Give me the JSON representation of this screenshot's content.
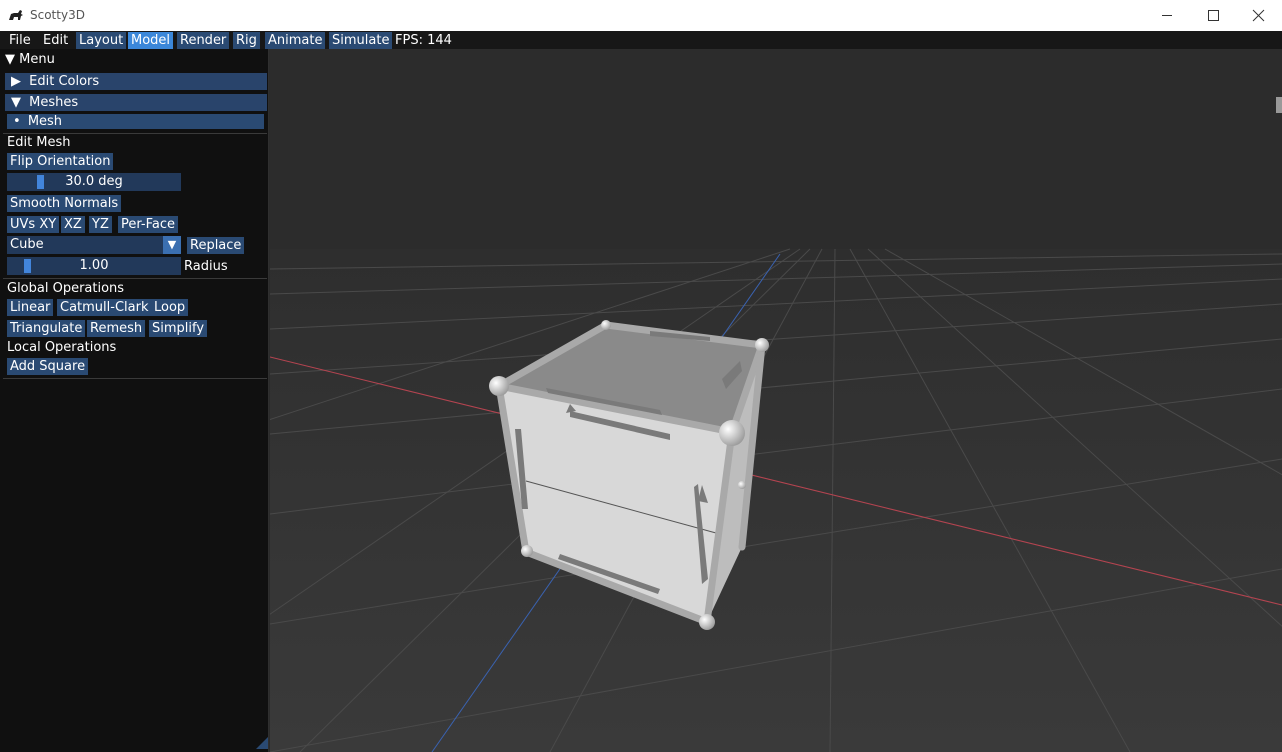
{
  "window": {
    "title": "Scotty3D"
  },
  "menubar": {
    "items": [
      {
        "label": "File",
        "style": "plain"
      },
      {
        "label": "Edit",
        "style": "plain"
      },
      {
        "label": "Layout",
        "style": "boxed"
      },
      {
        "label": "Model",
        "style": "active"
      },
      {
        "label": "Render",
        "style": "boxed"
      },
      {
        "label": "Rig",
        "style": "boxed"
      },
      {
        "label": "Animate",
        "style": "boxed"
      },
      {
        "label": "Simulate",
        "style": "boxed"
      }
    ],
    "fps_label": "FPS: 144"
  },
  "panel": {
    "menu_header": "Menu",
    "edit_colors": "Edit Colors",
    "meshes": "Meshes",
    "mesh_item": "Mesh",
    "edit_mesh": "Edit Mesh",
    "flip_orientation": "Flip Orientation",
    "angle_value": "30.0 deg",
    "angle_fraction": 0.17,
    "smooth_normals": "Smooth Normals",
    "uv_buttons": [
      "UVs XY",
      "XZ",
      "YZ",
      "Per-Face"
    ],
    "shape_select": "Cube",
    "replace": "Replace",
    "radius_value": "1.00",
    "radius_fraction": 0.1,
    "radius_label": "Radius",
    "global_operations": "Global Operations",
    "global_buttons_row1": [
      "Linear",
      "Catmull-Clark",
      "Loop"
    ],
    "global_buttons_row2": [
      "Triangulate",
      "Remesh",
      "Simplify"
    ],
    "local_operations": "Local Operations",
    "add_square": "Add Square"
  },
  "colors": {
    "accent": "#3b87d9",
    "button": "#2a4a73",
    "header": "#29446b",
    "x_axis": "#b44450",
    "z_axis": "#3a62b0",
    "viewport_bg": "#373737"
  }
}
